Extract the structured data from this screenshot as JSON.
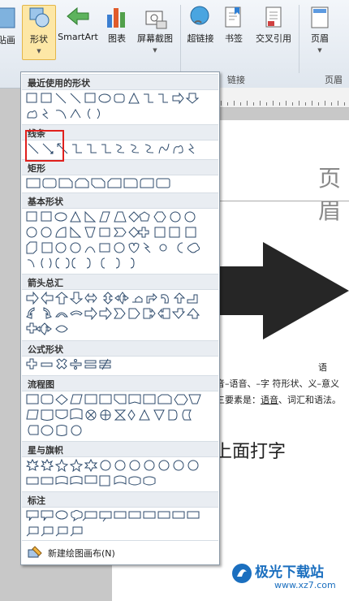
{
  "ribbon": {
    "buttons": {
      "picture_partial": "贴画",
      "shapes": "形状",
      "smartart": "SmartArt",
      "chart": "图表",
      "screenshot": "屏幕截图",
      "hyperlink": "超链接",
      "bookmark": "书签",
      "crossref": "交叉引用",
      "header": "页眉"
    },
    "groups": {
      "links": "链接",
      "header_footer_partial": "页眉"
    }
  },
  "gallery": {
    "sections": {
      "recent": "最近使用的形状",
      "lines": "线条",
      "rect": "矩形",
      "basic": "基本形状",
      "arrows": "箭头总汇",
      "equation": "公式形状",
      "flowchart": "流程图",
      "stars": "星与旗帜",
      "callouts": "标注"
    },
    "footer_label": "新建绘图画布(N)"
  },
  "document": {
    "header_text": "页眉",
    "line1": "语",
    "line2": "音–语音、–字 符形状、义–意义",
    "line3": "三要素是：语音、词汇和语法。",
    "line3_prefix": "三要素是：",
    "line3_u1": "语音",
    "line3_rest": "、词汇和语法。",
    "line4": "上面打字"
  },
  "watermark": {
    "title": "极光下载站",
    "url": "www.xz7.com"
  },
  "colors": {
    "accent": "#1a6dc7",
    "highlight": "#e0201d",
    "selected": "#fde7a6"
  }
}
